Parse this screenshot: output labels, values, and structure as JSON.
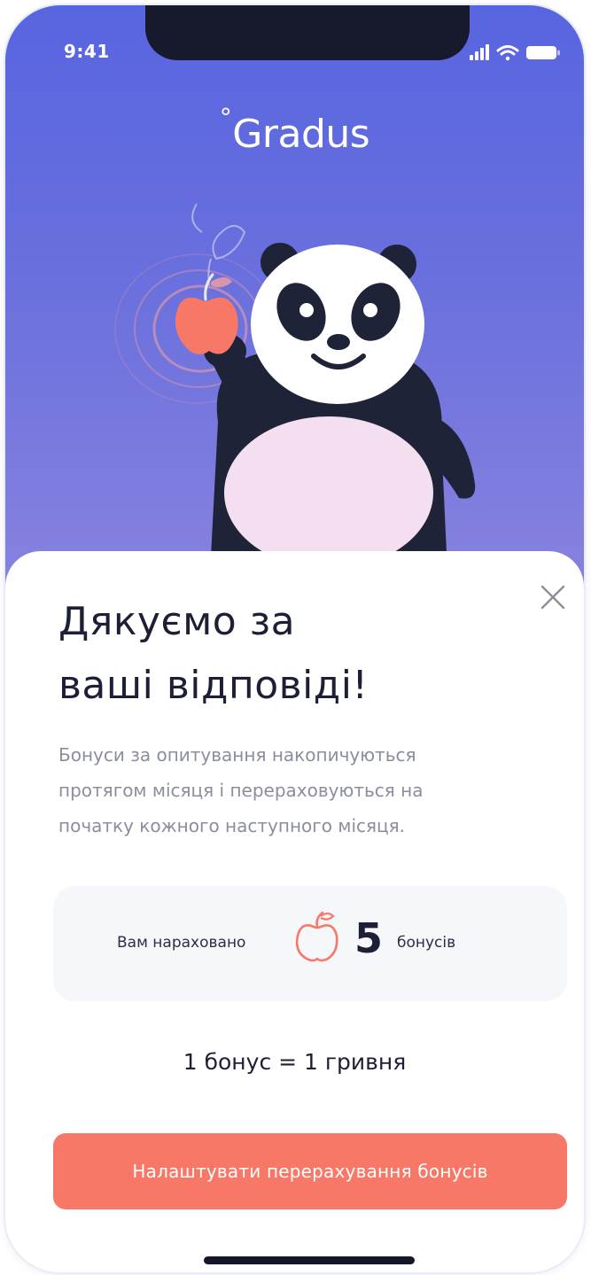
{
  "status_bar": {
    "time": "9:41",
    "signal_icon": "cellular-signal-icon",
    "wifi_icon": "wifi-icon",
    "battery_icon": "battery-icon"
  },
  "header": {
    "logo_text": "Gradus",
    "logo_symbol": "°"
  },
  "illustration": {
    "subject": "panda-holding-apple",
    "apple_color": "#f87868"
  },
  "dialog": {
    "title_line1": "Дякуємо за",
    "title_line2": "ваші відповіді!",
    "description_line1": "Бонуси за опитування накопичуються",
    "description_line2": "протягом місяця і перераховуються на",
    "description_line3": "початку кожного наступного місяця.",
    "close_icon": "close-icon",
    "bonus": {
      "label": "Вам нараховано",
      "icon": "apple-outline-icon",
      "value": "5",
      "unit": "бонусів"
    },
    "rate": "1 бонус = 1 гривня",
    "cta_label": "Налаштувати перерахування бонусів"
  },
  "colors": {
    "header_gradient_top": "#5865e0",
    "header_gradient_bottom": "#8b84df",
    "accent": "#f87868",
    "title": "#1c1f35",
    "muted_text": "#8a8e9e",
    "card_bg": "#f6f7fb"
  }
}
